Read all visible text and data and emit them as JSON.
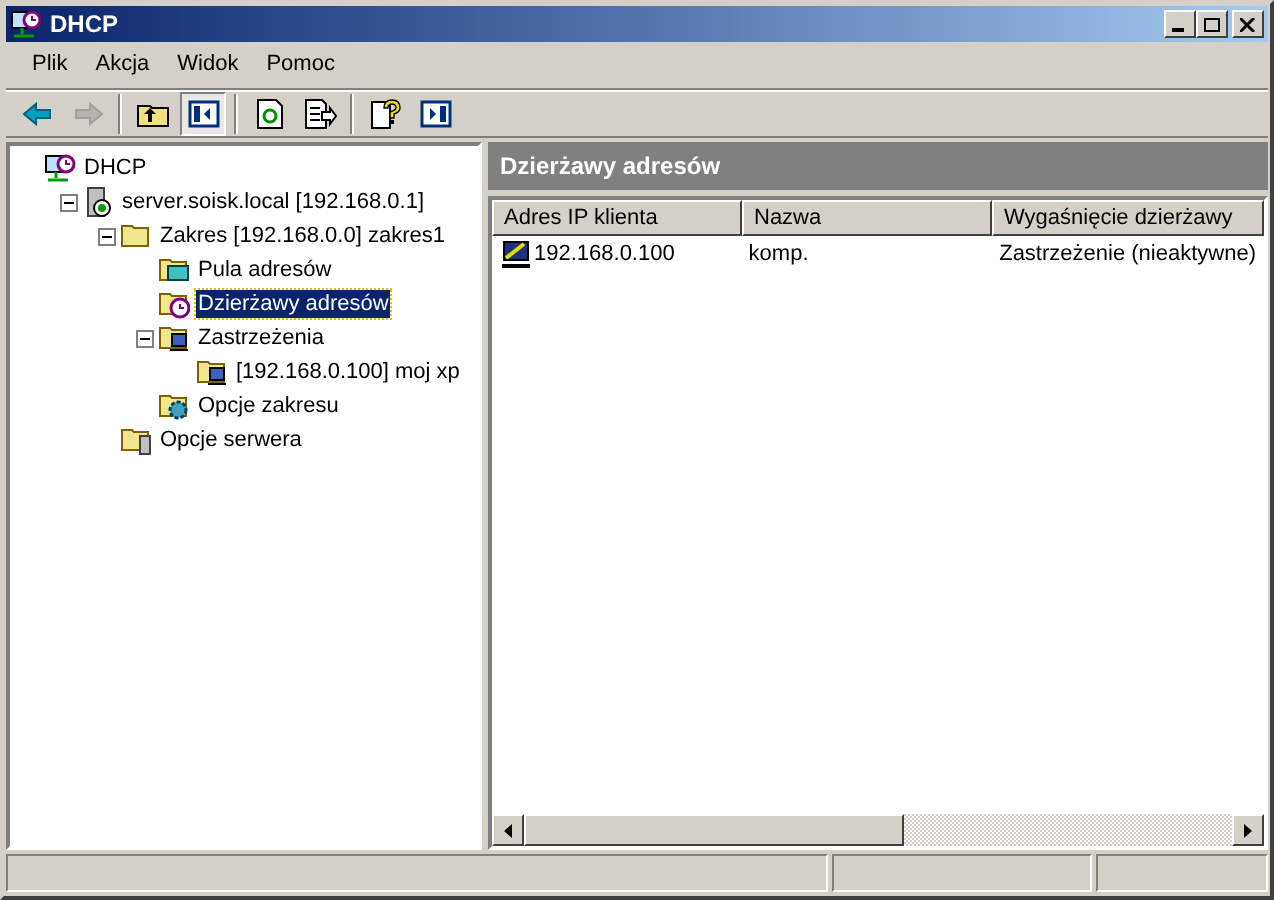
{
  "window": {
    "title": "DHCP"
  },
  "menu": [
    "Plik",
    "Akcja",
    "Widok",
    "Pomoc"
  ],
  "toolbar": [
    {
      "kind": "back",
      "disabled": false,
      "selected": false
    },
    {
      "kind": "forward",
      "disabled": true,
      "selected": false
    },
    {
      "kind": "up",
      "disabled": false,
      "selected": false
    },
    {
      "kind": "tree",
      "disabled": false,
      "selected": true
    },
    {
      "kind": "refresh",
      "disabled": false,
      "selected": false
    },
    {
      "kind": "export",
      "disabled": false,
      "selected": false
    },
    {
      "kind": "help",
      "disabled": false,
      "selected": false
    },
    {
      "kind": "pane",
      "disabled": false,
      "selected": false
    }
  ],
  "tree": [
    {
      "label": "DHCP",
      "kind": "root",
      "selected": false,
      "children": [
        {
          "label": "server.soisk.local [192.168.0.1]",
          "kind": "server",
          "expanded": true,
          "selected": false,
          "children": [
            {
              "label": "Zakres [192.168.0.0] zakres1",
              "kind": "folder",
              "expanded": true,
              "selected": false,
              "children": [
                {
                  "label": "Pula adresów",
                  "kind": "pool",
                  "selected": false
                },
                {
                  "label": "Dzierżawy adresów",
                  "kind": "leases",
                  "selected": true
                },
                {
                  "label": "Zastrzeżenia",
                  "kind": "reservations",
                  "expanded": true,
                  "selected": false,
                  "children": [
                    {
                      "label": "[192.168.0.100] moj xp",
                      "kind": "reservation",
                      "selected": false
                    }
                  ]
                },
                {
                  "label": "Opcje zakresu",
                  "kind": "options",
                  "selected": false
                }
              ]
            },
            {
              "label": "Opcje serwera",
              "kind": "serveroptions",
              "selected": false
            }
          ]
        }
      ]
    }
  ],
  "details": {
    "title": "Dzierżawy adresów",
    "columns": [
      "Adres IP klienta",
      "Nazwa",
      "Wygaśnięcie dzierżawy"
    ],
    "rows": [
      [
        "192.168.0.100",
        "komp.",
        "Zastrzeżenie (nieaktywne)"
      ]
    ]
  }
}
